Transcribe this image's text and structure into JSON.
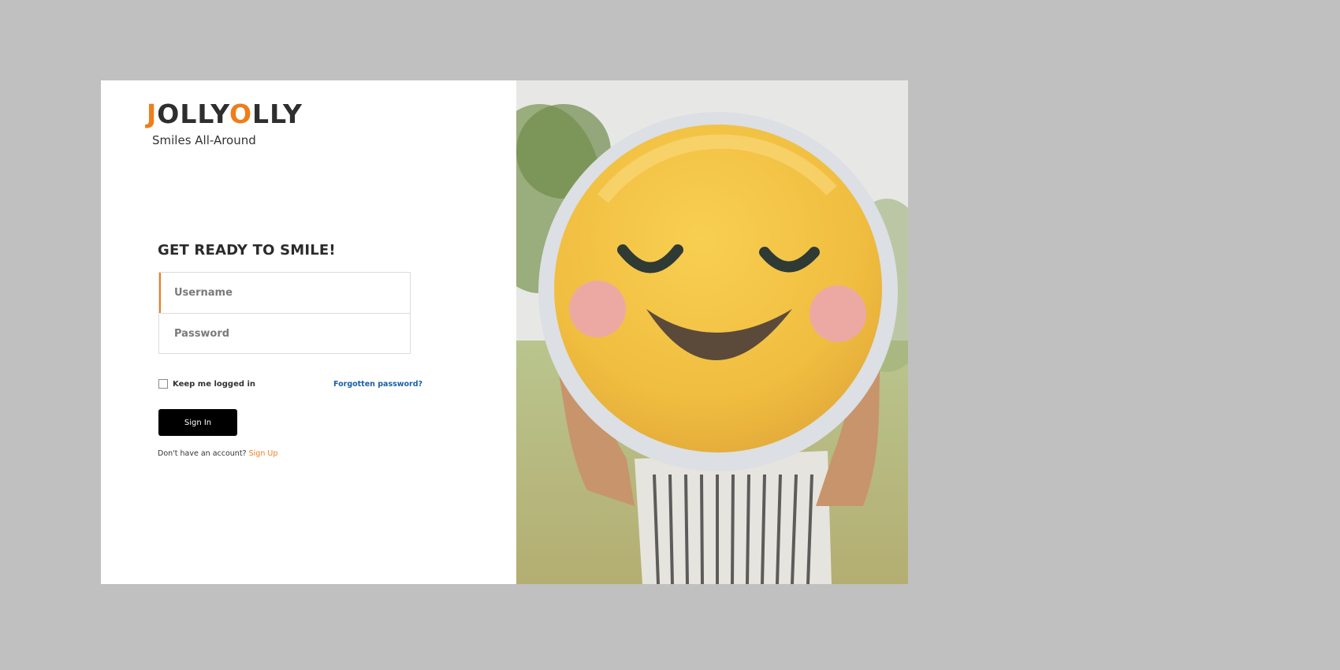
{
  "brand": {
    "logo_prefix_accent": "J",
    "logo_part_1": "OLLY",
    "logo_accent_2": "O",
    "logo_part_2": "LLY",
    "tagline": "Smiles All-Around",
    "accent_color": "#ef7d1a",
    "logo_color": "#2e2e2e"
  },
  "login_form": {
    "title": "GET READY TO SMILE!",
    "username_placeholder": "Username",
    "password_placeholder": "Password",
    "remember_label": "Keep me logged in",
    "remember_checked": false,
    "forgot_password_label": "Forgotten password?",
    "signin_label": "Sign In",
    "signup_prompt": "Don't have an account?",
    "signup_link_label": "Sign Up"
  },
  "colors": {
    "page_background": "#c0c0c0",
    "link_blue": "#1a5fa8",
    "button_background": "#000000"
  },
  "hero_image": {
    "subject": "person holding a smiley face sign",
    "icons": [
      "smiley-face-sign"
    ]
  }
}
